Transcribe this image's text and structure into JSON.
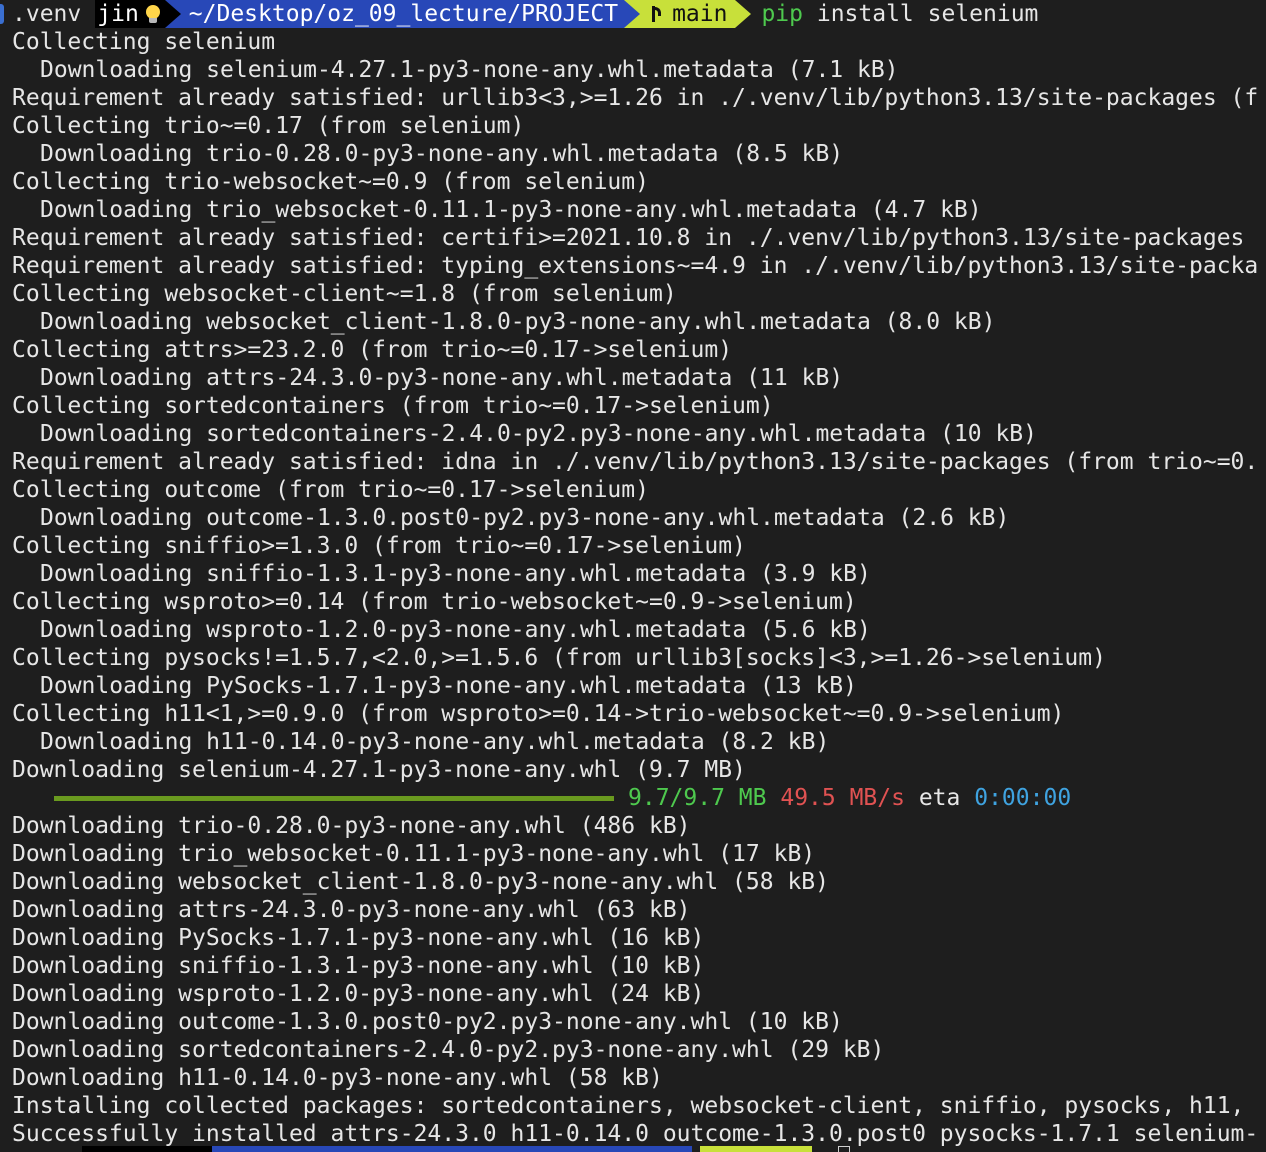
{
  "prompt": {
    "venv": ".venv",
    "user": "jin",
    "bulb_icon": "lightbulb-icon",
    "path": "~/Desktop/oz_09_lecture/PROJECT",
    "branch_icon": "git-branch-icon",
    "branch": "main",
    "command_bin": "pip",
    "command_args": " install selenium"
  },
  "colors": {
    "background": "#1e1e1e",
    "path_segment": "#2848b8",
    "git_segment": "#c8e03a",
    "progress_bar": "#6a9a1f",
    "progress_size": "#4ec94e",
    "progress_speed": "#e05252",
    "progress_eta": "#3fa3e0"
  },
  "output": [
    {
      "text": "Collecting selenium",
      "indent": false
    },
    {
      "text": "Downloading selenium-4.27.1-py3-none-any.whl.metadata (7.1 kB)",
      "indent": true
    },
    {
      "text": "Requirement already satisfied: urllib3<3,>=1.26 in ./.venv/lib/python3.13/site-packages (f",
      "indent": false
    },
    {
      "text": "Collecting trio~=0.17 (from selenium)",
      "indent": false
    },
    {
      "text": "Downloading trio-0.28.0-py3-none-any.whl.metadata (8.5 kB)",
      "indent": true
    },
    {
      "text": "Collecting trio-websocket~=0.9 (from selenium)",
      "indent": false
    },
    {
      "text": "Downloading trio_websocket-0.11.1-py3-none-any.whl.metadata (4.7 kB)",
      "indent": true
    },
    {
      "text": "Requirement already satisfied: certifi>=2021.10.8 in ./.venv/lib/python3.13/site-packages",
      "indent": false
    },
    {
      "text": "Requirement already satisfied: typing_extensions~=4.9 in ./.venv/lib/python3.13/site-packa",
      "indent": false
    },
    {
      "text": "Collecting websocket-client~=1.8 (from selenium)",
      "indent": false
    },
    {
      "text": "Downloading websocket_client-1.8.0-py3-none-any.whl.metadata (8.0 kB)",
      "indent": true
    },
    {
      "text": "Collecting attrs>=23.2.0 (from trio~=0.17->selenium)",
      "indent": false
    },
    {
      "text": "Downloading attrs-24.3.0-py3-none-any.whl.metadata (11 kB)",
      "indent": true
    },
    {
      "text": "Collecting sortedcontainers (from trio~=0.17->selenium)",
      "indent": false
    },
    {
      "text": "Downloading sortedcontainers-2.4.0-py2.py3-none-any.whl.metadata (10 kB)",
      "indent": true
    },
    {
      "text": "Requirement already satisfied: idna in ./.venv/lib/python3.13/site-packages (from trio~=0.",
      "indent": false
    },
    {
      "text": "Collecting outcome (from trio~=0.17->selenium)",
      "indent": false
    },
    {
      "text": "Downloading outcome-1.3.0.post0-py2.py3-none-any.whl.metadata (2.6 kB)",
      "indent": true
    },
    {
      "text": "Collecting sniffio>=1.3.0 (from trio~=0.17->selenium)",
      "indent": false
    },
    {
      "text": "Downloading sniffio-1.3.1-py3-none-any.whl.metadata (3.9 kB)",
      "indent": true
    },
    {
      "text": "Collecting wsproto>=0.14 (from trio-websocket~=0.9->selenium)",
      "indent": false
    },
    {
      "text": "Downloading wsproto-1.2.0-py3-none-any.whl.metadata (5.6 kB)",
      "indent": true
    },
    {
      "text": "Collecting pysocks!=1.5.7,<2.0,>=1.5.6 (from urllib3[socks]<3,>=1.26->selenium)",
      "indent": false
    },
    {
      "text": "Downloading PySocks-1.7.1-py3-none-any.whl.metadata (13 kB)",
      "indent": true
    },
    {
      "text": "Collecting h11<1,>=0.9.0 (from wsproto>=0.14->trio-websocket~=0.9->selenium)",
      "indent": false
    },
    {
      "text": "Downloading h11-0.14.0-py3-none-any.whl.metadata (8.2 kB)",
      "indent": true
    },
    {
      "text": "Downloading selenium-4.27.1-py3-none-any.whl (9.7 MB)",
      "indent": false
    }
  ],
  "progress": {
    "fraction": 1.0,
    "size": "9.7/9.7 MB",
    "speed": "49.5 MB/s",
    "eta_label": "eta",
    "eta": "0:00:00"
  },
  "output_after": [
    {
      "text": "Downloading trio-0.28.0-py3-none-any.whl (486 kB)"
    },
    {
      "text": "Downloading trio_websocket-0.11.1-py3-none-any.whl (17 kB)"
    },
    {
      "text": "Downloading websocket_client-1.8.0-py3-none-any.whl (58 kB)"
    },
    {
      "text": "Downloading attrs-24.3.0-py3-none-any.whl (63 kB)"
    },
    {
      "text": "Downloading PySocks-1.7.1-py3-none-any.whl (16 kB)"
    },
    {
      "text": "Downloading sniffio-1.3.1-py3-none-any.whl (10 kB)"
    },
    {
      "text": "Downloading wsproto-1.2.0-py3-none-any.whl (24 kB)"
    },
    {
      "text": "Downloading outcome-1.3.0.post0-py2.py3-none-any.whl (10 kB)"
    },
    {
      "text": "Downloading sortedcontainers-2.4.0-py2.py3-none-any.whl (29 kB)"
    },
    {
      "text": "Downloading h11-0.14.0-py3-none-any.whl (58 kB)"
    },
    {
      "text": "Installing collected packages: sortedcontainers, websocket-client, sniffio, pysocks, h11,"
    },
    {
      "text": "Successfully installed attrs-24.3.0 h11-0.14.0 outcome-1.3.0.post0 pysocks-1.7.1 selenium-"
    }
  ]
}
